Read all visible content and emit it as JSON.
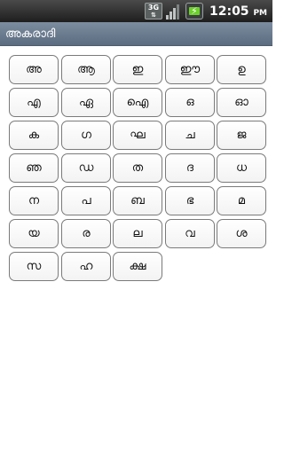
{
  "status_bar": {
    "network_label": "3G",
    "time": "12:05",
    "ampm": "PM"
  },
  "title": "അകരാദി",
  "keys": [
    "അ",
    "ആ",
    "ഇ",
    "ഈ",
    "ഉ",
    "എ",
    "ഏ",
    "ഐ",
    "ഒ",
    "ഓ",
    "ക",
    "ഗ",
    "ഘ",
    "ച",
    "ജ",
    "ഞ",
    "ഡ",
    "ത",
    "ദ",
    "ധ",
    "ന",
    "പ",
    "ബ",
    "ഭ",
    "മ",
    "യ",
    "ര",
    "ല",
    "വ",
    "ശ",
    "സ",
    "ഹ",
    "ക്ഷ"
  ]
}
